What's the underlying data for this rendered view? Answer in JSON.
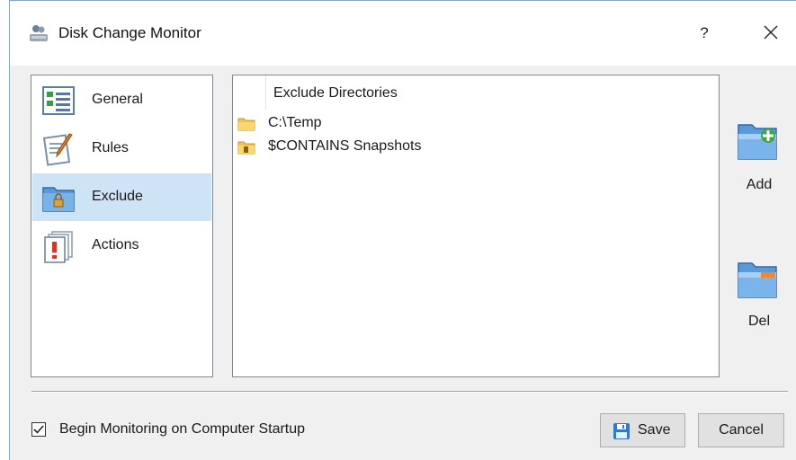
{
  "window": {
    "title": "Disk Change Monitor",
    "help_label": "?"
  },
  "nav": {
    "items": [
      {
        "label": "General",
        "icon": "general-icon",
        "selected": false
      },
      {
        "label": "Rules",
        "icon": "rules-icon",
        "selected": false
      },
      {
        "label": "Exclude",
        "icon": "exclude-folder-icon",
        "selected": true
      },
      {
        "label": "Actions",
        "icon": "actions-icon",
        "selected": false
      }
    ]
  },
  "list": {
    "header": "Exclude Directories",
    "rows": [
      {
        "text": "C:\\Temp",
        "icon": "folder-icon"
      },
      {
        "text": "$CONTAINS Snapshots",
        "icon": "folder-filter-icon"
      }
    ]
  },
  "actions": {
    "add_label": "Add",
    "del_label": "Del"
  },
  "footer": {
    "startup_checkbox_label": "Begin Monitoring on Computer Startup",
    "startup_checked": true,
    "save_label": "Save",
    "cancel_label": "Cancel"
  },
  "colors": {
    "selection": "#cde3f6",
    "accent": "#2b7bd3",
    "dialog_bg": "#f0f0f0"
  }
}
